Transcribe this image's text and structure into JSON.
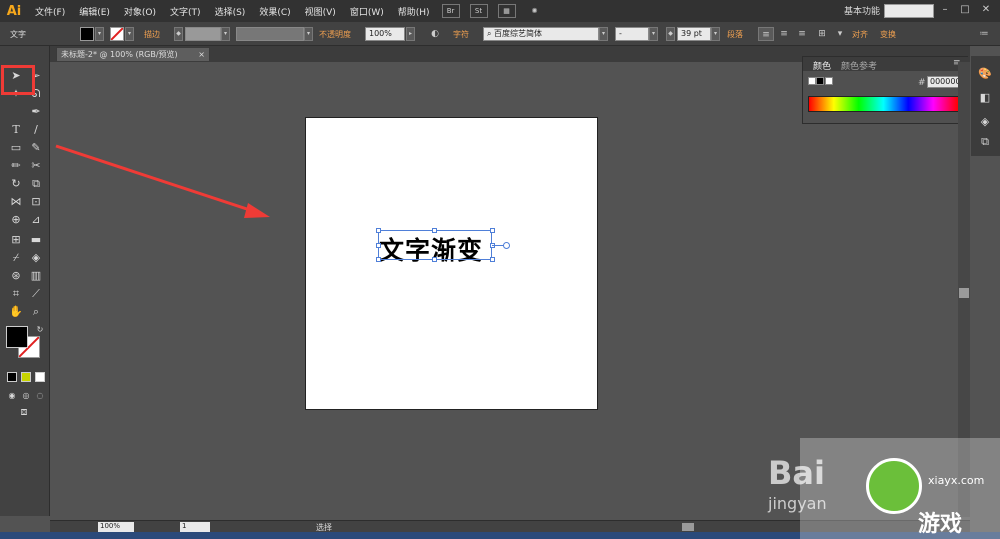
{
  "app": {
    "logo": "Ai"
  },
  "menu": [
    "文件(F)",
    "编辑(E)",
    "对象(O)",
    "文字(T)",
    "选择(S)",
    "效果(C)",
    "视图(V)",
    "窗口(W)",
    "帮助(H)"
  ],
  "menubar_icons": {
    "br_label": "Br",
    "st_label": "St"
  },
  "workspace": {
    "label": "基本功能",
    "search_placeholder": ""
  },
  "control": {
    "tool_label": "文字",
    "stroke_label": "描边",
    "opacity_label": "不透明度",
    "opacity_value": "100%",
    "char_label": "字符",
    "font_value": "百度综艺简体",
    "font_style_value": "-",
    "font_size_value": "39 pt",
    "para_label": "段落",
    "align_label": "对齐",
    "transform_label": "变换"
  },
  "document": {
    "tab_title": "未标题-2* @ 100% (RGB/预览)",
    "close_glyph": "×"
  },
  "artboard": {
    "headline": "文字渐变"
  },
  "colorpanel": {
    "tab_color": "颜色",
    "tab_guide": "颜色参考",
    "hex_value": "000000"
  },
  "status": {
    "zoom": "100%",
    "page": "1",
    "tool": "选择"
  },
  "watermark": {
    "line1": "Bai",
    "line2": "jingyan",
    "site": "xiayx.com",
    "game": "游戏"
  },
  "colors": {
    "accent": "#f7a81b",
    "highlight": "#ef3b36",
    "selection": "#4f7fd8"
  }
}
